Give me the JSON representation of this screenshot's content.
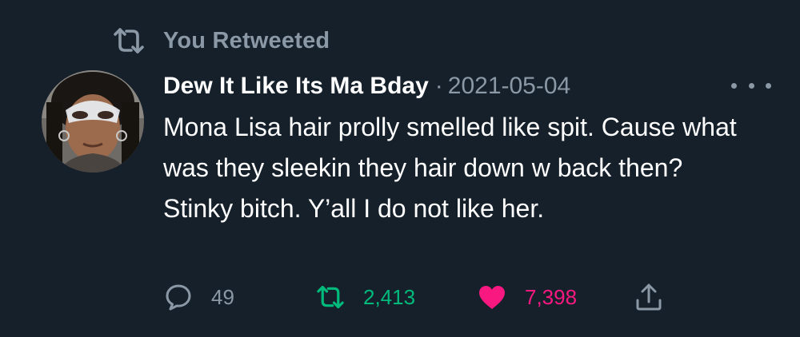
{
  "retweet_banner": {
    "icon": "retweet-icon",
    "label": "You Retweeted"
  },
  "tweet": {
    "avatar_icon": "avatar",
    "display_name": "Dew It Like Its Ma Bday",
    "separator": "·",
    "date": "2021-05-04",
    "text": "Mona Lisa hair prolly smelled like spit. Cause what was they sleekin they hair down w back then? Stinky bitch. Y’all I do not like her."
  },
  "actions": {
    "reply": {
      "icon": "reply-icon",
      "count": "49"
    },
    "retweet": {
      "icon": "retweet-icon",
      "count": "2,413"
    },
    "like": {
      "icon": "heart-icon",
      "count": "7,398"
    },
    "share": {
      "icon": "share-icon"
    }
  },
  "colors": {
    "background": "#15202b",
    "muted": "#8b98a5",
    "retweet_active": "#00ba7c",
    "like_active": "#f91880",
    "text": "#ffffff"
  }
}
